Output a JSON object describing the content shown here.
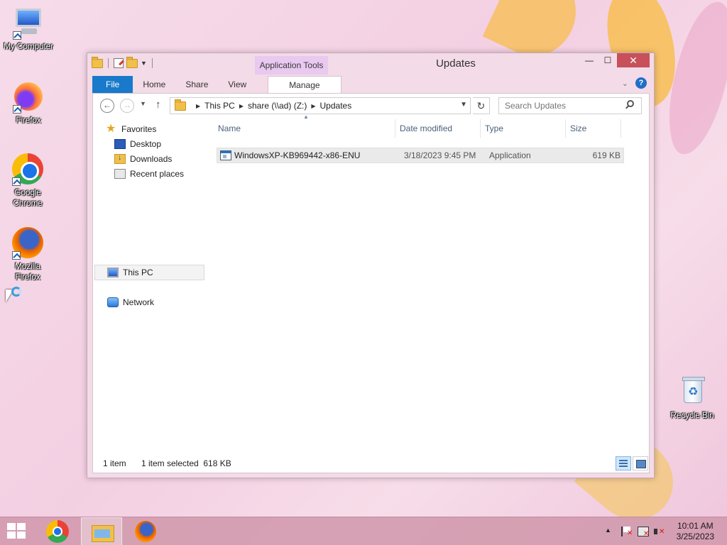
{
  "desktop": {
    "icons": [
      {
        "label": "My Computer"
      },
      {
        "label": "Firefox"
      },
      {
        "label": "Google Chrome"
      },
      {
        "label": "Mozilla Firefox"
      },
      {
        "label": "Recycle Bin"
      }
    ]
  },
  "window": {
    "title": "Updates",
    "contextual_tab_group": "Application Tools",
    "ribbon_tabs": [
      "File",
      "Home",
      "Share",
      "View",
      "Manage"
    ],
    "caption": {
      "minimize": "—",
      "maximize": "☐",
      "close": "✕"
    },
    "help": "?"
  },
  "address_bar": {
    "breadcrumbs": [
      "This PC",
      "share (\\\\ad) (Z:)",
      "Updates"
    ],
    "search_placeholder": "Search Updates"
  },
  "nav_pane": {
    "favorites_label": "Favorites",
    "favorites": [
      "Desktop",
      "Downloads",
      "Recent places"
    ],
    "this_pc": "This PC",
    "network": "Network"
  },
  "file_list": {
    "columns": [
      "Name",
      "Date modified",
      "Type",
      "Size"
    ],
    "rows": [
      {
        "name": "WindowsXP-KB969442-x86-ENU",
        "date": "3/18/2023 9:45 PM",
        "type": "Application",
        "size": "619 KB"
      }
    ]
  },
  "status": {
    "item_count": "1 item",
    "selection": "1 item selected  618 KB"
  },
  "taskbar": {
    "time": "10:01 AM",
    "date": "3/25/2023"
  }
}
